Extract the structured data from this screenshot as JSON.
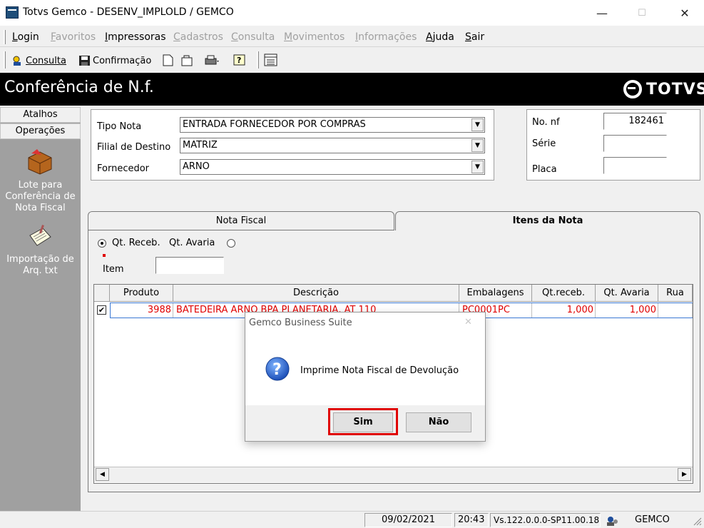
{
  "window": {
    "title": "Totvs Gemco - DESENV_IMPLOLD / GEMCO",
    "minimize": "—",
    "maximize": "☐",
    "close": "✕"
  },
  "menu": {
    "items": [
      "Login",
      "Favoritos",
      "Impressoras",
      "Cadastros",
      "Consulta",
      "Movimentos",
      "Informações",
      "Ajuda",
      "Sair"
    ]
  },
  "toolbar": {
    "consulta": "Consulta",
    "confirmacao": "Confirmação"
  },
  "header": {
    "title": "Conferência de N.f.",
    "brand": "TOTVS"
  },
  "sidebar": {
    "tabs": [
      "Atalhos",
      "Operações"
    ],
    "items": [
      {
        "label": "Lote para Conferência de Nota Fiscal",
        "icon": "package-icon"
      },
      {
        "label": "Importação de Arq. txt",
        "icon": "document-import-icon"
      }
    ]
  },
  "form": {
    "tipo_nota_label": "Tipo Nota",
    "tipo_nota_value": "ENTRADA FORNECEDOR POR COMPRAS",
    "filial_label": "Filial de Destino",
    "filial_value": "MATRIZ",
    "fornecedor_label": "Fornecedor",
    "fornecedor_value": "ARNO",
    "nf_label": "No. nf",
    "nf_value": "182461",
    "serie_label": "Série",
    "serie_value": "",
    "placa_label": "Placa",
    "placa_value": ""
  },
  "tabs": {
    "nota_fiscal": "Nota Fiscal",
    "itens": "Itens da Nota"
  },
  "filters": {
    "qt_receb": "Qt. Receb.",
    "qt_avaria": "Qt. Avaria",
    "item_label": "Item",
    "item_value": ""
  },
  "grid": {
    "columns": [
      "Produto",
      "Descrição",
      "Embalagens",
      "Qt.receb.",
      "Qt. Avaria",
      "Rua"
    ],
    "rows": [
      {
        "produto": "3988",
        "descricao": "BATEDEIRA ARNO BPA PLANETARIA, AT 110",
        "embalagens": "PC0001PC",
        "qt_receb": "1,000",
        "qt_avaria": "1,000",
        "rua": ""
      }
    ]
  },
  "dialog": {
    "title": "Gemco Business Suite",
    "message": "Imprime Nota Fiscal de Devolução",
    "yes": "Sim",
    "no": "Não",
    "highlight_color": "#e00000"
  },
  "status": {
    "date": "09/02/2021",
    "time": "20:43",
    "version": "Vs.122.0.0.0-SP11.00.18",
    "user": "GEMCO"
  }
}
